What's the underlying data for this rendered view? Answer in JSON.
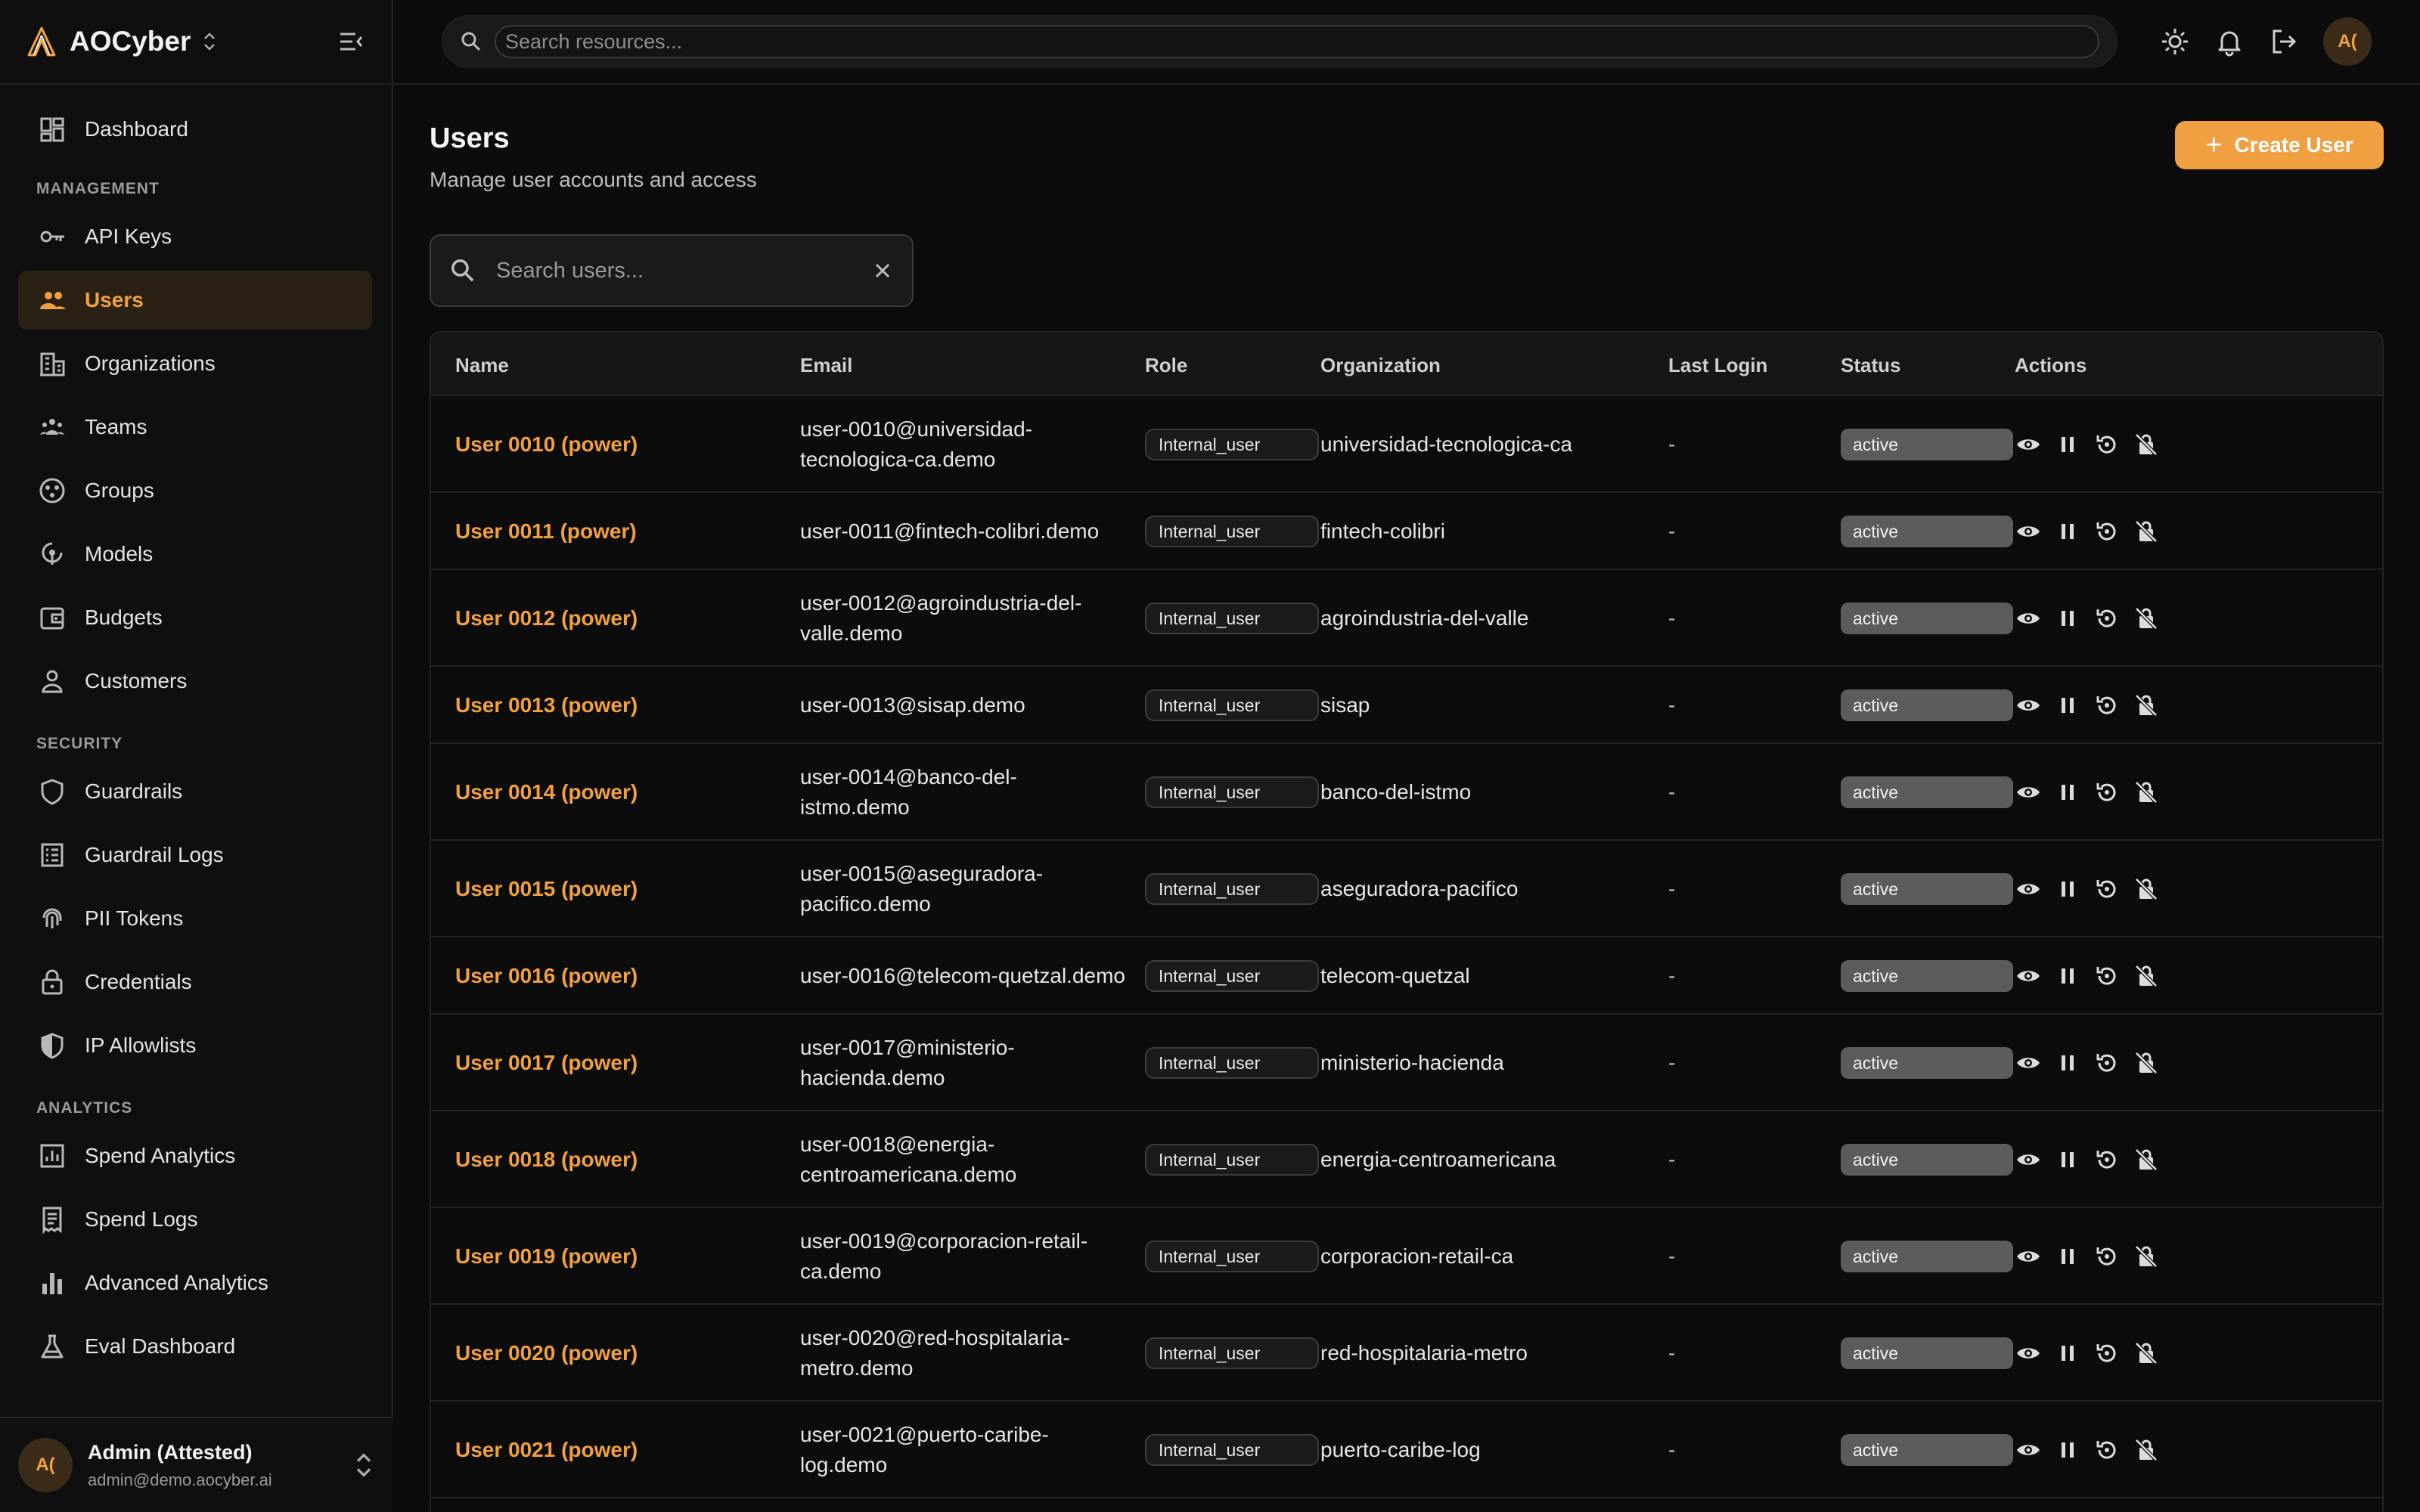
{
  "brand": {
    "name": "AOCyber"
  },
  "nav": {
    "top": [
      {
        "label": "Dashboard",
        "icon": "dashboard-icon"
      }
    ],
    "sections": [
      {
        "label": "MANAGEMENT",
        "items": [
          {
            "label": "API Keys",
            "icon": "key-icon"
          },
          {
            "label": "Users",
            "icon": "users-icon",
            "active": true
          },
          {
            "label": "Organizations",
            "icon": "building-icon"
          },
          {
            "label": "Teams",
            "icon": "teams-icon"
          },
          {
            "label": "Groups",
            "icon": "groups-icon"
          },
          {
            "label": "Models",
            "icon": "models-icon"
          },
          {
            "label": "Budgets",
            "icon": "wallet-icon"
          },
          {
            "label": "Customers",
            "icon": "person-icon"
          }
        ]
      },
      {
        "label": "SECURITY",
        "items": [
          {
            "label": "Guardrails",
            "icon": "shield-icon"
          },
          {
            "label": "Guardrail Logs",
            "icon": "logs-icon"
          },
          {
            "label": "PII Tokens",
            "icon": "fingerprint-icon"
          },
          {
            "label": "Credentials",
            "icon": "lock-icon"
          },
          {
            "label": "IP Allowlists",
            "icon": "shield-half-icon"
          }
        ]
      },
      {
        "label": "ANALYTICS",
        "items": [
          {
            "label": "Spend Analytics",
            "icon": "analytics-icon"
          },
          {
            "label": "Spend Logs",
            "icon": "receipt-icon"
          },
          {
            "label": "Advanced Analytics",
            "icon": "bar-chart-icon"
          },
          {
            "label": "Eval Dashboard",
            "icon": "flask-icon"
          }
        ]
      }
    ]
  },
  "current_user": {
    "initials": "A(",
    "name": "Admin (Attested)",
    "email": "admin@demo.aocyber.ai"
  },
  "header": {
    "search_placeholder": "Search resources...",
    "avatar_initials": "A("
  },
  "page": {
    "title": "Users",
    "subtitle": "Manage user accounts and access",
    "create_label": "Create User",
    "search_placeholder": "Search users..."
  },
  "table": {
    "columns": [
      "Name",
      "Email",
      "Role",
      "Organization",
      "Last Login",
      "Status",
      "Actions"
    ],
    "rows": [
      {
        "name": "User 0010 (power)",
        "email": [
          "user-0010@universidad-",
          "tecnologica-ca.demo"
        ],
        "role": "Internal_user",
        "org": "universidad-tecnologica-ca",
        "last_login": "-",
        "status": "active"
      },
      {
        "name": "User 0011 (power)",
        "email": [
          "user-0011@fintech-colibri.demo"
        ],
        "role": "Internal_user",
        "org": "fintech-colibri",
        "last_login": "-",
        "status": "active"
      },
      {
        "name": "User 0012 (power)",
        "email": [
          "user-0012@agroindustria-del-",
          "valle.demo"
        ],
        "role": "Internal_user",
        "org": "agroindustria-del-valle",
        "last_login": "-",
        "status": "active"
      },
      {
        "name": "User 0013 (power)",
        "email": [
          "user-0013@sisap.demo"
        ],
        "role": "Internal_user",
        "org": "sisap",
        "last_login": "-",
        "status": "active"
      },
      {
        "name": "User 0014 (power)",
        "email": [
          "user-0014@banco-del-",
          "istmo.demo"
        ],
        "role": "Internal_user",
        "org": "banco-del-istmo",
        "last_login": "-",
        "status": "active"
      },
      {
        "name": "User 0015 (power)",
        "email": [
          "user-0015@aseguradora-",
          "pacifico.demo"
        ],
        "role": "Internal_user",
        "org": "aseguradora-pacifico",
        "last_login": "-",
        "status": "active"
      },
      {
        "name": "User 0016 (power)",
        "email": [
          "user-0016@telecom-quetzal.demo"
        ],
        "role": "Internal_user",
        "org": "telecom-quetzal",
        "last_login": "-",
        "status": "active"
      },
      {
        "name": "User 0017 (power)",
        "email": [
          "user-0017@ministerio-",
          "hacienda.demo"
        ],
        "role": "Internal_user",
        "org": "ministerio-hacienda",
        "last_login": "-",
        "status": "active"
      },
      {
        "name": "User 0018 (power)",
        "email": [
          "user-0018@energia-",
          "centroamericana.demo"
        ],
        "role": "Internal_user",
        "org": "energia-centroamericana",
        "last_login": "-",
        "status": "active"
      },
      {
        "name": "User 0019 (power)",
        "email": [
          "user-0019@corporacion-retail-",
          "ca.demo"
        ],
        "role": "Internal_user",
        "org": "corporacion-retail-ca",
        "last_login": "-",
        "status": "active"
      },
      {
        "name": "User 0020 (power)",
        "email": [
          "user-0020@red-hospitalaria-",
          "metro.demo"
        ],
        "role": "Internal_user",
        "org": "red-hospitalaria-metro",
        "last_login": "-",
        "status": "active"
      },
      {
        "name": "User 0021 (power)",
        "email": [
          "user-0021@puerto-caribe-",
          "log.demo"
        ],
        "role": "Internal_user",
        "org": "puerto-caribe-log",
        "last_login": "-",
        "status": "active"
      }
    ]
  },
  "colors": {
    "accent": "#f0a040",
    "background": "#0c0c0c",
    "status_badge": "#5c5c5c"
  }
}
